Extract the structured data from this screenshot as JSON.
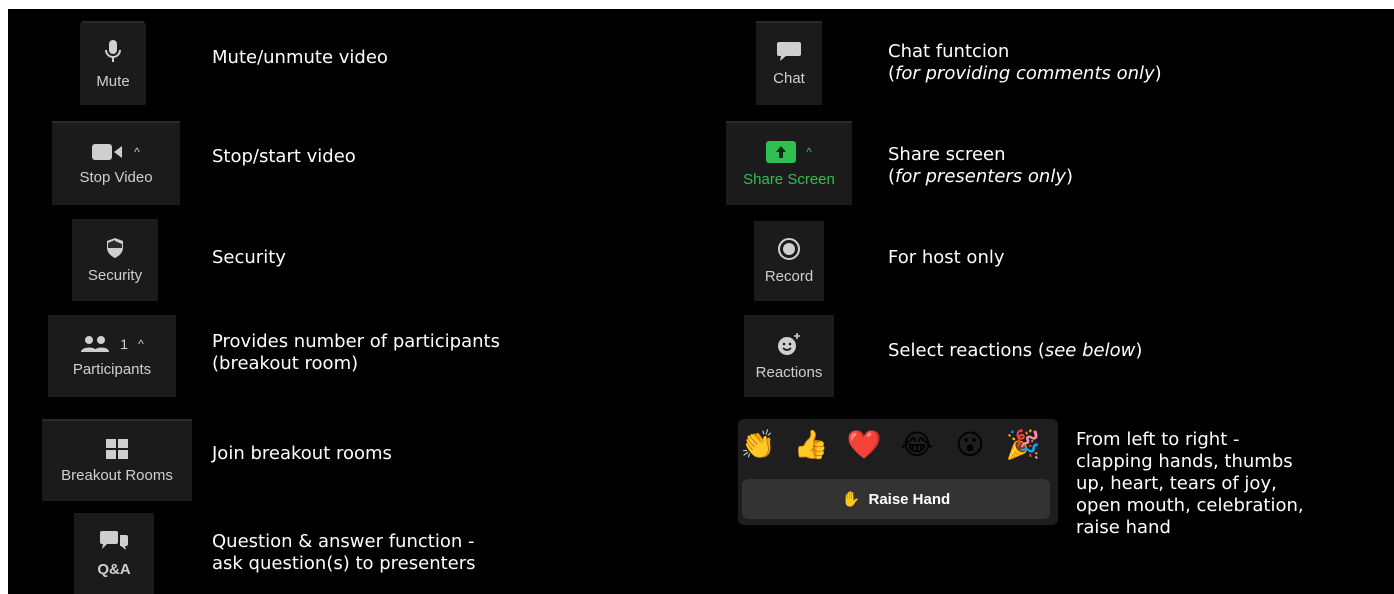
{
  "left_items": [
    {
      "label": "Mute",
      "desc_plain": "Mute/unmute video",
      "icon": "microphone-icon"
    },
    {
      "label": "Stop Video",
      "desc_plain": "Stop/start video",
      "icon": "video-camera-icon"
    },
    {
      "label": "Security",
      "desc_plain": "Security",
      "icon": "shield-icon"
    },
    {
      "label": "Participants",
      "count": "1",
      "desc_line1": "Provides number of participants",
      "desc_line2": "(breakout room)",
      "icon": "participants-icon"
    },
    {
      "label": "Breakout Rooms",
      "desc_plain": "Join breakout rooms",
      "icon": "grid-icon"
    },
    {
      "label": "Q&A",
      "desc_line1": "Question & answer function -",
      "desc_line2": "ask question(s) to presenters",
      "icon": "qa-bubbles-icon"
    }
  ],
  "right_items": [
    {
      "label": "Chat",
      "desc_line1": "Chat funtcion",
      "desc_open": "(",
      "desc_italic": "for providing comments only",
      "desc_close": ")",
      "icon": "chat-bubble-icon"
    },
    {
      "label": "Share Screen",
      "desc_line1": "Share screen",
      "desc_open": "(",
      "desc_italic": "for presenters only",
      "desc_close": ")",
      "icon": "share-arrow-icon"
    },
    {
      "label": "Record",
      "desc_plain": "For host only",
      "icon": "record-icon"
    },
    {
      "label": "Reactions",
      "desc_pre": "Select reactions (",
      "desc_italic": "see below",
      "desc_post": ")",
      "icon": "smiley-plus-icon"
    }
  ],
  "reactions": {
    "emojis": [
      {
        "name": "clapping-hands",
        "glyph": "👏"
      },
      {
        "name": "thumbs-up",
        "glyph": "👍"
      },
      {
        "name": "heart",
        "glyph": "❤️"
      },
      {
        "name": "tears-of-joy",
        "glyph": "😂"
      },
      {
        "name": "open-mouth",
        "glyph": "😮"
      },
      {
        "name": "celebration",
        "glyph": "🎉"
      }
    ],
    "raise_hand_label": "Raise Hand",
    "raise_hand_glyph": "✋",
    "desc_lines": [
      "From left to right -",
      "clapping hands, thumbs",
      "up, heart, tears of joy,",
      "open mouth, celebration,",
      "raise hand"
    ]
  },
  "colors": {
    "background": "#000000",
    "tile": "#1b1b1b",
    "text": "#ffffff",
    "label": "#cfcfcf",
    "share_green": "#2fc052"
  }
}
